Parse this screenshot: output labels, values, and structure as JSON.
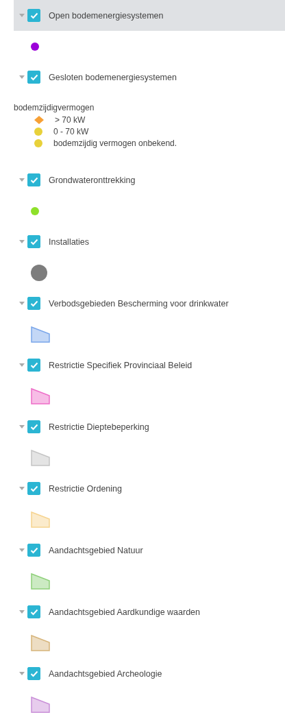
{
  "layers": [
    {
      "name": "Open bodemenergiesystemen",
      "checked": true,
      "expanded": true,
      "selected": true,
      "legend": {
        "symbols": [
          {
            "kind": "dot",
            "color": "#9b00d9"
          }
        ]
      }
    },
    {
      "name": "Gesloten bodemenergiesystemen",
      "checked": true,
      "expanded": true,
      "selected": false,
      "legend": {
        "heading": "bodemzijdigvermogen",
        "symbols": [
          {
            "kind": "diamond",
            "color": "#f7a035",
            "label": "> 70 kW"
          },
          {
            "kind": "ball",
            "color": "#e8d13a",
            "label": "0 - 70 kW"
          },
          {
            "kind": "ball",
            "color": "#e8d13a",
            "label": "bodemzijdig vermogen onbekend."
          }
        ]
      }
    },
    {
      "name": "Grondwateronttrekking",
      "checked": true,
      "expanded": true,
      "selected": false,
      "legend": {
        "symbols": [
          {
            "kind": "dot",
            "color": "#8ee02a"
          }
        ]
      }
    },
    {
      "name": "Installaties",
      "checked": true,
      "expanded": true,
      "selected": false,
      "legend": {
        "symbols": [
          {
            "kind": "circle",
            "color": "#7d7d7d"
          }
        ]
      }
    },
    {
      "name": "Verbodsgebieden Bescherming voor drinkwater",
      "checked": true,
      "expanded": true,
      "selected": false,
      "legend": {
        "symbols": [
          {
            "kind": "polygon",
            "color": "#7aa6ea"
          }
        ]
      }
    },
    {
      "name": "Restrictie Specifiek Provinciaal Beleid",
      "checked": true,
      "expanded": true,
      "selected": false,
      "legend": {
        "symbols": [
          {
            "kind": "polygon",
            "color": "#ee6cc8"
          }
        ]
      }
    },
    {
      "name": "Restrictie Dieptebeperking",
      "checked": true,
      "expanded": true,
      "selected": false,
      "legend": {
        "symbols": [
          {
            "kind": "polygon",
            "color": "#c4c4c4"
          }
        ]
      }
    },
    {
      "name": "Restrictie Ordening",
      "checked": true,
      "expanded": true,
      "selected": false,
      "legend": {
        "symbols": [
          {
            "kind": "polygon",
            "color": "#f6d38e"
          }
        ]
      }
    },
    {
      "name": "Aandachtsgebied Natuur",
      "checked": true,
      "expanded": true,
      "selected": false,
      "legend": {
        "symbols": [
          {
            "kind": "polygon",
            "color": "#8ed07a"
          }
        ]
      }
    },
    {
      "name": "Aandachtsgebied Aardkundige waarden",
      "checked": true,
      "expanded": true,
      "selected": false,
      "legend": {
        "symbols": [
          {
            "kind": "polygon",
            "color": "#d6b47a"
          }
        ]
      }
    },
    {
      "name": "Aandachtsgebied Archeologie",
      "checked": true,
      "expanded": true,
      "selected": false,
      "legend": {
        "symbols": [
          {
            "kind": "polygon",
            "color": "#c98fd8"
          }
        ]
      }
    }
  ]
}
